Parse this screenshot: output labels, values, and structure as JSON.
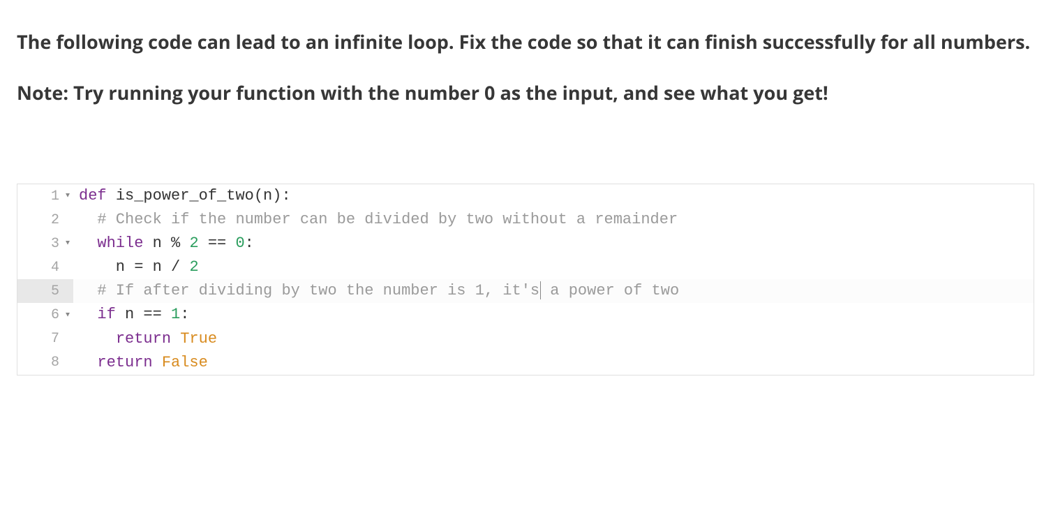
{
  "question": {
    "paragraph1": "The following code can lead to an infinite loop. Fix the code so that it can finish successfully for all numbers.",
    "paragraph2": "Note: Try running your function with the number 0 as the input, and see what you get!"
  },
  "editor": {
    "active_line": 5,
    "lines": [
      {
        "num": "1",
        "fold": true,
        "tokens": [
          {
            "t": "def",
            "c": "tok-keyword"
          },
          {
            "t": " ",
            "c": ""
          },
          {
            "t": "is_power_of_two",
            "c": "tok-funcname"
          },
          {
            "t": "(n):",
            "c": "tok-paren"
          }
        ]
      },
      {
        "num": "2",
        "fold": false,
        "tokens": [
          {
            "t": "  ",
            "c": ""
          },
          {
            "t": "# Check if the number can be divided by two without a remainder",
            "c": "tok-comment"
          }
        ]
      },
      {
        "num": "3",
        "fold": true,
        "tokens": [
          {
            "t": "  ",
            "c": ""
          },
          {
            "t": "while",
            "c": "tok-keyword"
          },
          {
            "t": " n ",
            "c": "tok-ident"
          },
          {
            "t": "%",
            "c": "tok-op"
          },
          {
            "t": " ",
            "c": ""
          },
          {
            "t": "2",
            "c": "tok-number"
          },
          {
            "t": " ",
            "c": ""
          },
          {
            "t": "==",
            "c": "tok-op"
          },
          {
            "t": " ",
            "c": ""
          },
          {
            "t": "0",
            "c": "tok-number"
          },
          {
            "t": ":",
            "c": "tok-op"
          }
        ]
      },
      {
        "num": "4",
        "fold": false,
        "tokens": [
          {
            "t": "    n ",
            "c": "tok-ident"
          },
          {
            "t": "=",
            "c": "tok-op"
          },
          {
            "t": " n ",
            "c": "tok-ident"
          },
          {
            "t": "/",
            "c": "tok-op"
          },
          {
            "t": " ",
            "c": ""
          },
          {
            "t": "2",
            "c": "tok-number"
          }
        ]
      },
      {
        "num": "5",
        "fold": false,
        "cursor_after_token": 1,
        "tokens": [
          {
            "t": "  ",
            "c": ""
          },
          {
            "t": "# If after dividing by two the number is 1, it's",
            "c": "tok-comment"
          },
          {
            "t": " a power of two",
            "c": "tok-comment"
          }
        ]
      },
      {
        "num": "6",
        "fold": true,
        "tokens": [
          {
            "t": "  ",
            "c": ""
          },
          {
            "t": "if",
            "c": "tok-keyword"
          },
          {
            "t": " n ",
            "c": "tok-ident"
          },
          {
            "t": "==",
            "c": "tok-op"
          },
          {
            "t": " ",
            "c": ""
          },
          {
            "t": "1",
            "c": "tok-number"
          },
          {
            "t": ":",
            "c": "tok-op"
          }
        ]
      },
      {
        "num": "7",
        "fold": false,
        "tokens": [
          {
            "t": "    ",
            "c": ""
          },
          {
            "t": "return",
            "c": "tok-keyword"
          },
          {
            "t": " ",
            "c": ""
          },
          {
            "t": "True",
            "c": "tok-bool"
          }
        ]
      },
      {
        "num": "8",
        "fold": false,
        "tokens": [
          {
            "t": "  ",
            "c": ""
          },
          {
            "t": "return",
            "c": "tok-keyword"
          },
          {
            "t": " ",
            "c": ""
          },
          {
            "t": "False",
            "c": "tok-bool"
          }
        ]
      }
    ]
  }
}
